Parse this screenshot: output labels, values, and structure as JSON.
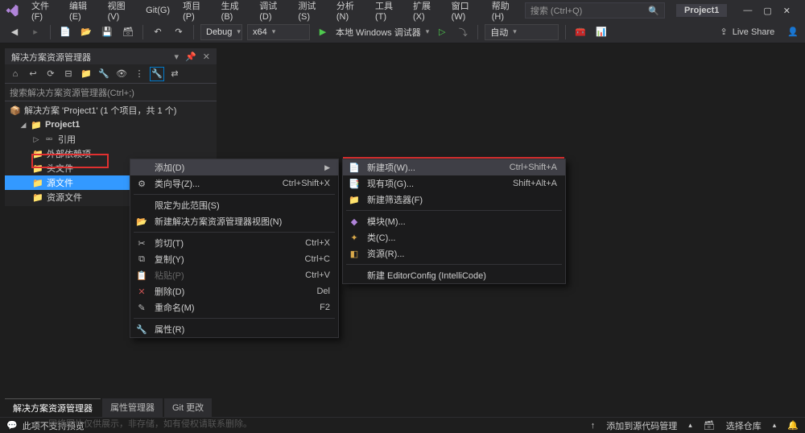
{
  "menubar": {
    "items": [
      "文件(F)",
      "编辑(E)",
      "视图(V)",
      "Git(G)",
      "项目(P)",
      "生成(B)",
      "调试(D)",
      "测试(S)",
      "分析(N)",
      "工具(T)",
      "扩展(X)",
      "窗口(W)",
      "帮助(H)"
    ],
    "search_placeholder": "搜索 (Ctrl+Q)",
    "project_title": "Project1"
  },
  "toolbar": {
    "config": "Debug",
    "platform": "x64",
    "debugger": "本地 Windows 调试器",
    "auto": "自动",
    "liveshare": "Live Share"
  },
  "sln": {
    "panel_title": "解决方案资源管理器",
    "search_placeholder": "搜索解决方案资源管理器(Ctrl+;)",
    "solution": "解决方案 'Project1' (1 个项目，共 1 个)",
    "project": "Project1",
    "nodes": {
      "refs": "引用",
      "ext": "外部依赖项",
      "headers": "头文件",
      "source": "源文件",
      "resource": "资源文件"
    }
  },
  "ctx1": {
    "add": "添加(D)",
    "wizard": "类向导(Z)...",
    "wizard_sc": "Ctrl+Shift+X",
    "scope": "限定为此范围(S)",
    "newview": "新建解决方案资源管理器视图(N)",
    "cut": "剪切(T)",
    "cut_sc": "Ctrl+X",
    "copy": "复制(Y)",
    "copy_sc": "Ctrl+C",
    "paste": "粘贴(P)",
    "paste_sc": "Ctrl+V",
    "delete": "删除(D)",
    "delete_sc": "Del",
    "rename": "重命名(M)",
    "rename_sc": "F2",
    "properties": "属性(R)"
  },
  "ctx2": {
    "newitem": "新建项(W)...",
    "newitem_sc": "Ctrl+Shift+A",
    "existing": "现有项(G)...",
    "existing_sc": "Shift+Alt+A",
    "newfilter": "新建筛选器(F)",
    "module": "模块(M)...",
    "class": "类(C)...",
    "resource": "资源(R)...",
    "editorconfig": "新建 EditorConfig (IntelliCode)"
  },
  "bottom": {
    "tabs": [
      "解决方案资源管理器",
      "属性管理器",
      "Git 更改"
    ],
    "preview": "此项不支持预览"
  },
  "status": {
    "add_to_source": "添加到源代码管理",
    "select_repo": "选择仓库"
  },
  "watermark": "网络图片仅供展示，非存储，如有侵权请联系删除。"
}
